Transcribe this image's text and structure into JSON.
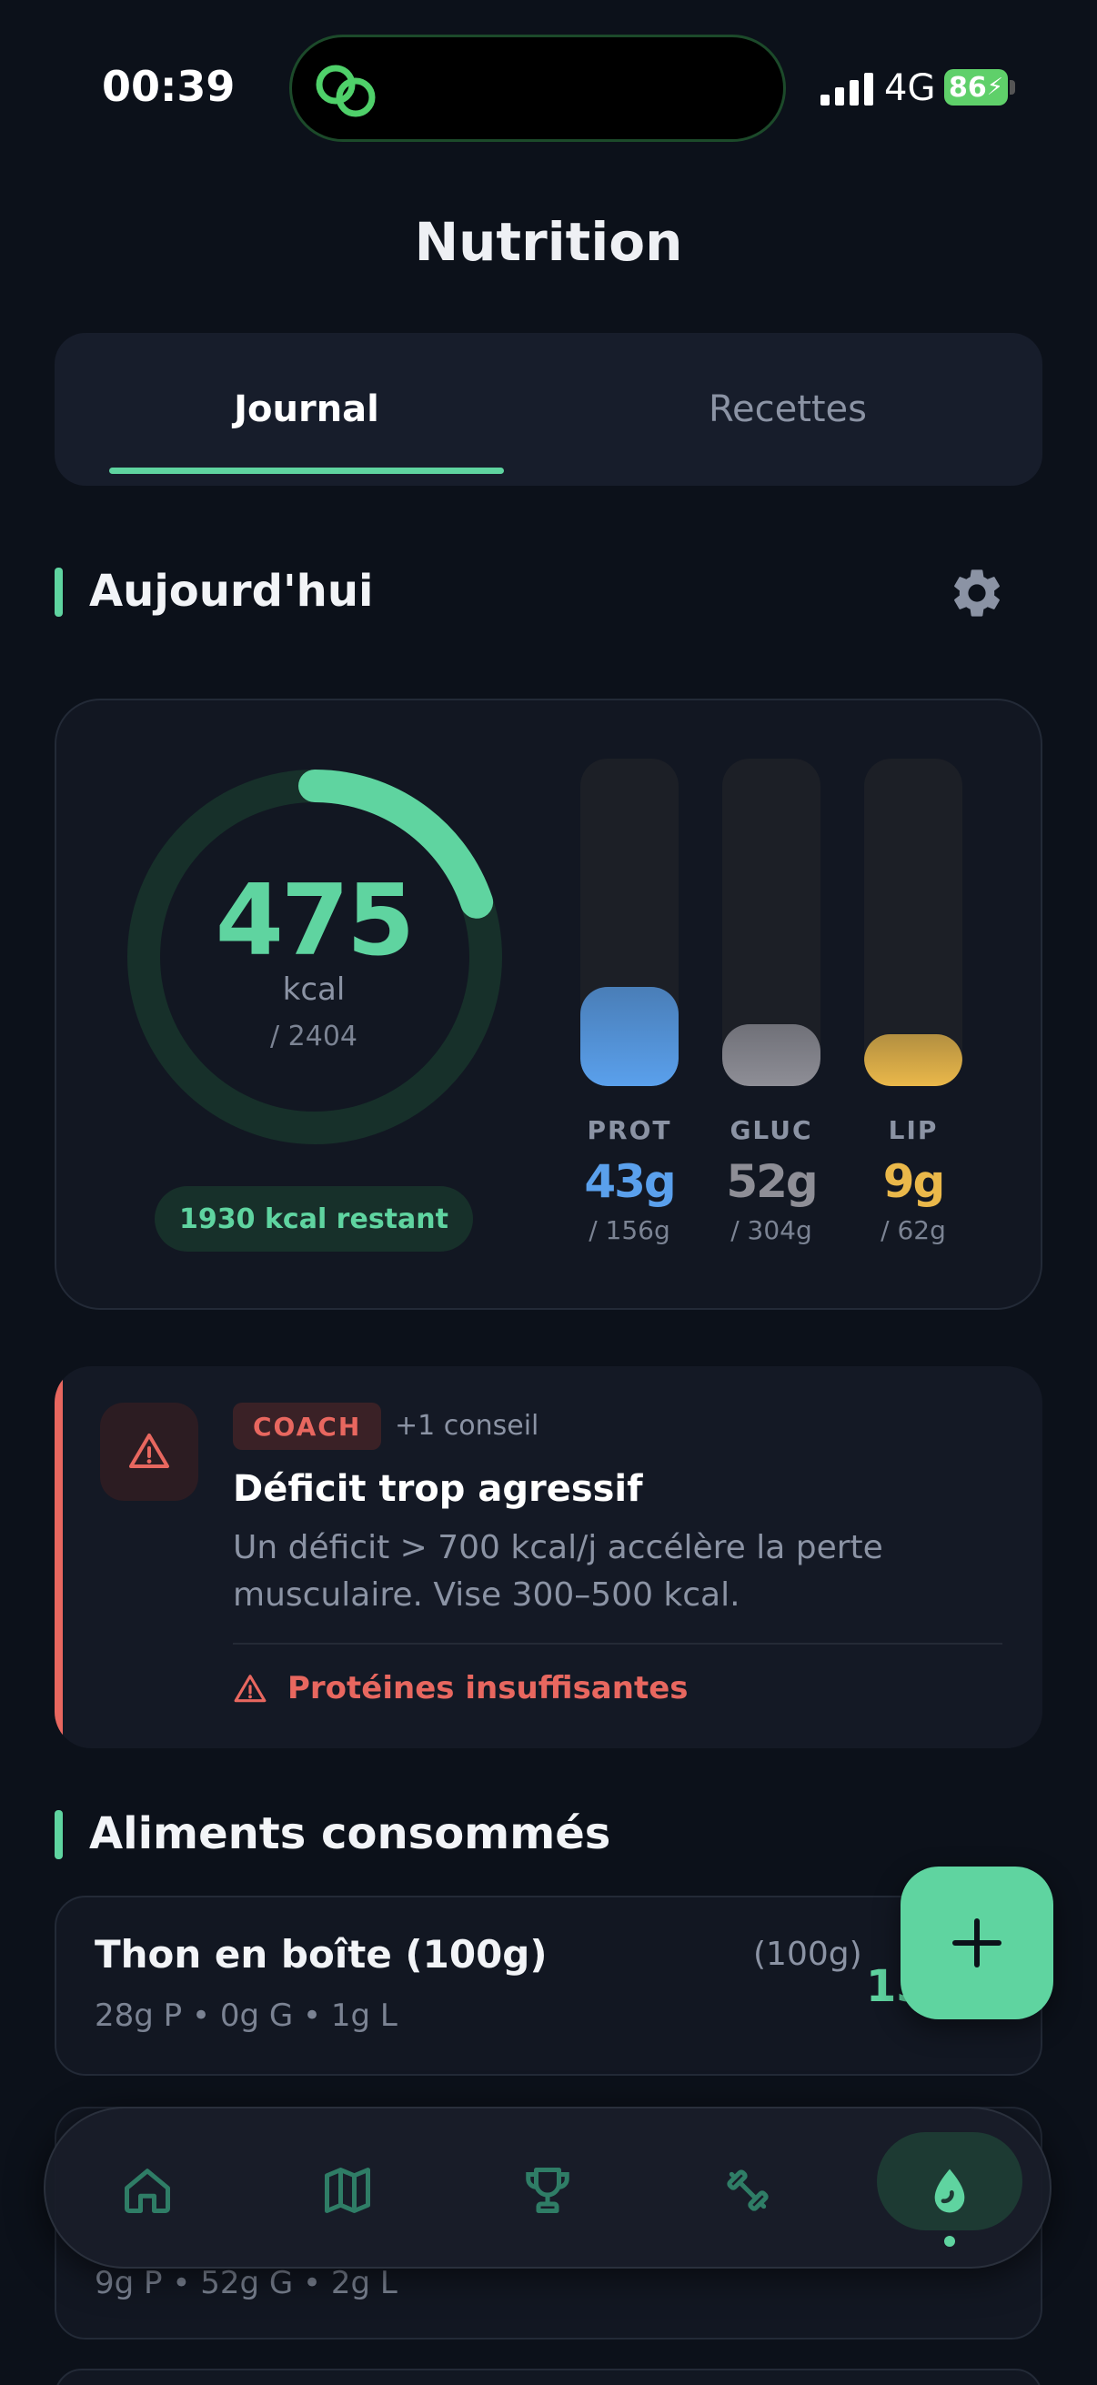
{
  "status_bar": {
    "time": "00:39",
    "network": "4G",
    "battery": "86"
  },
  "header": {
    "title": "Nutrition"
  },
  "tabs": [
    {
      "label": "Journal",
      "active": true
    },
    {
      "label": "Recettes",
      "active": false
    }
  ],
  "today": {
    "section_title": "Aujourd'hui",
    "calories": {
      "consumed": "475",
      "unit": "kcal",
      "goal": "/ 2404",
      "progress": 0.198
    },
    "remaining": "1930 kcal restant",
    "macros": [
      {
        "label": "PROT",
        "value": "43g",
        "goal": "/ 156g",
        "fill": 0.276,
        "color": "#5aa0ec"
      },
      {
        "label": "GLUC",
        "value": "52g",
        "goal": "/ 304g",
        "fill": 0.171,
        "color": "#8e8e96"
      },
      {
        "label": "LIP",
        "value": "9g",
        "goal": "/ 62g",
        "fill": 0.145,
        "color": "#eab84a"
      }
    ]
  },
  "coach": {
    "badge": "COACH",
    "extra": "+1 conseil",
    "title": "Déficit trop agressif",
    "text": "Un déficit > 700 kcal/j accélère la perte musculaire. Vise 300–500 kcal.",
    "warning": "Protéines insuffisantes"
  },
  "foods": {
    "section_title": "Aliments consommés",
    "items": [
      {
        "name": "Thon en boîte (100g)",
        "qty": "(100g)",
        "macros": "28g P • 0g G • 1g L",
        "kcal": "13"
      },
      {
        "name": "",
        "qty": "",
        "macros": "9g P • 52g G • 2g L",
        "kcal": ""
      }
    ]
  },
  "colors": {
    "accent": "#5fd4a0",
    "warning": "#e8675f",
    "background": "#0c111a"
  },
  "icons": {
    "island": "link-icon",
    "settings": "gear-icon",
    "coach": "warning-icon",
    "fab": "plus-icon",
    "nav": [
      "home-icon",
      "map-icon",
      "trophy-icon",
      "dumbbell-icon",
      "leaf-icon"
    ]
  }
}
